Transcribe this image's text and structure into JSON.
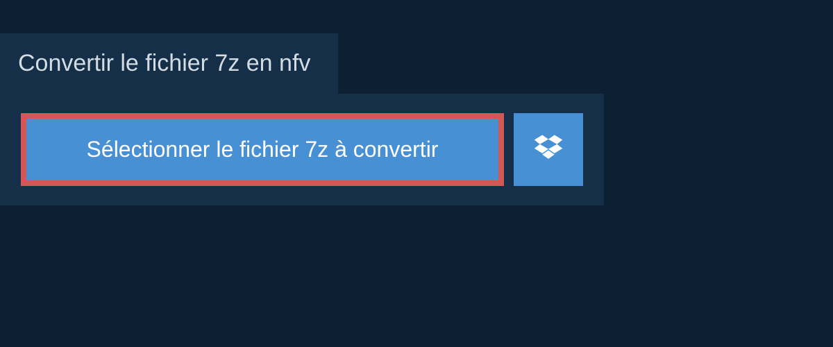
{
  "header": {
    "title": "Convertir le fichier 7z en nfv"
  },
  "actions": {
    "select_file_label": "Sélectionner le fichier 7z à convertir"
  }
}
